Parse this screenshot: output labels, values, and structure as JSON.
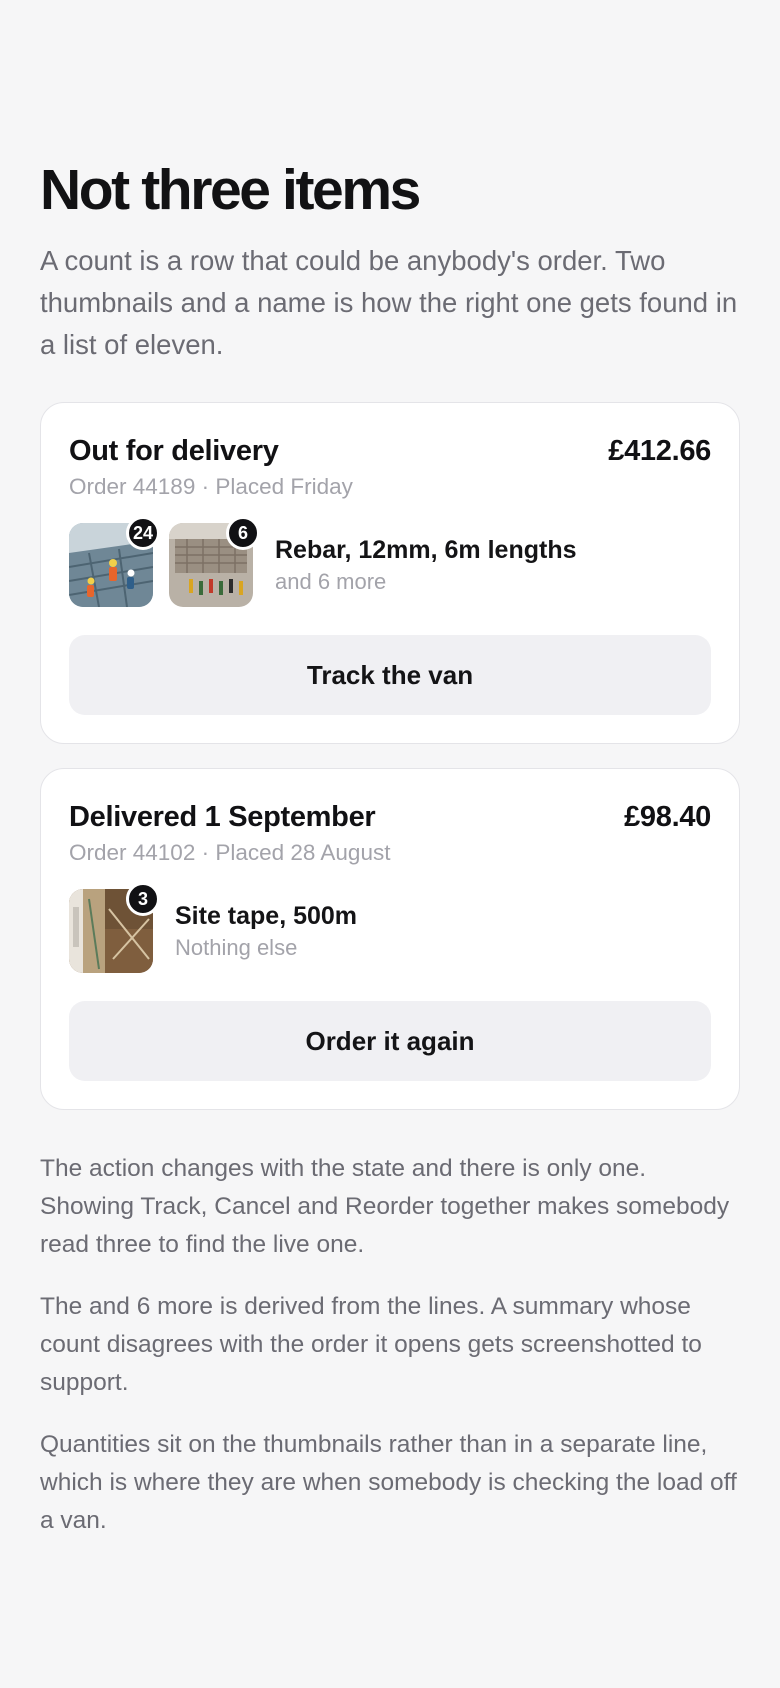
{
  "heading": "Not three items",
  "lede": "A count is a row that could be anybody's order. Two thumbnails and a name is how the right one gets found in a list of eleven.",
  "orders": [
    {
      "status": "Out for delivery",
      "price": "£412.66",
      "meta": "Order 44189 · Placed Friday",
      "thumbnails": [
        {
          "quantity": "24",
          "subject": "construction-workers-photo"
        },
        {
          "quantity": "6",
          "subject": "building-site-photo"
        }
      ],
      "item_name": "Rebar, 12mm, 6m lengths",
      "item_sub": "and 6 more",
      "action_label": "Track the van"
    },
    {
      "status": "Delivered 1 September",
      "price": "£98.40",
      "meta": "Order 44102 · Placed 28 August",
      "thumbnails": [
        {
          "quantity": "3",
          "subject": "interior-renovation-photo"
        }
      ],
      "item_name": "Site tape, 500m",
      "item_sub": "Nothing else",
      "action_label": "Order it again"
    }
  ],
  "notes": [
    "The action changes with the state and there is only one. Showing Track, Cancel and Reorder together makes somebody read three to find the live one.",
    "The and 6 more is derived from the lines. A summary whose count disagrees with the order it opens gets screenshotted to support.",
    "Quantities sit on the thumbnails rather than in a separate line, which is where they are when somebody is checking the load off a van."
  ],
  "colors": {
    "background": "#f6f6f7",
    "card": "#ffffff",
    "button": "#f0f0f3",
    "badge": "#111114",
    "muted_text": "#a3a3aa",
    "body_text": "#6b6b73"
  }
}
